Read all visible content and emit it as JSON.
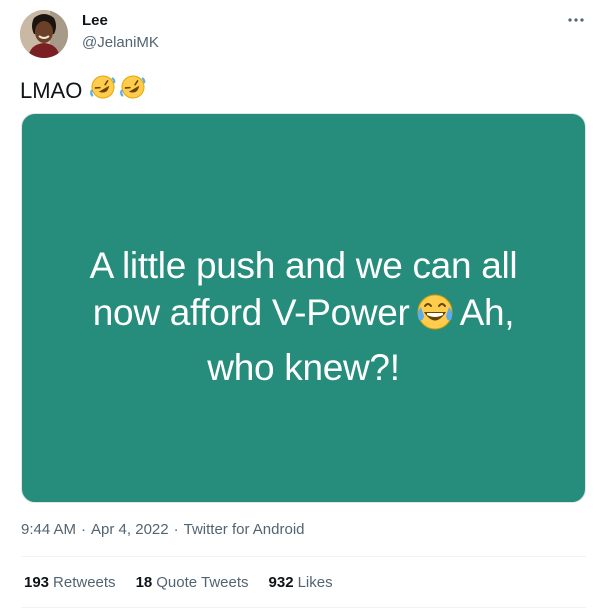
{
  "author": {
    "name": "Lee",
    "handle": "@JelaniMK"
  },
  "more_icon": "more-horizontal-icon",
  "tweet": {
    "text": "LMAO",
    "emojis": [
      "rolling-on-floor-laughing-emoji",
      "rolling-on-floor-laughing-emoji"
    ]
  },
  "media": {
    "background_color": "#268d7c",
    "line1": "A little push and we can all",
    "line2_before": "now afford V-Power",
    "line2_emoji": "face-with-tears-of-joy-emoji",
    "line2_after": "Ah,",
    "line3": "who knew?!"
  },
  "meta": {
    "time": "9:44 AM",
    "sep1": "·",
    "date": "Apr 4, 2022",
    "sep2": "·",
    "source": "Twitter for Android"
  },
  "stats": {
    "retweets_count": "193",
    "retweets_label": "Retweets",
    "quotes_count": "18",
    "quotes_label": "Quote Tweets",
    "likes_count": "932",
    "likes_label": "Likes"
  }
}
